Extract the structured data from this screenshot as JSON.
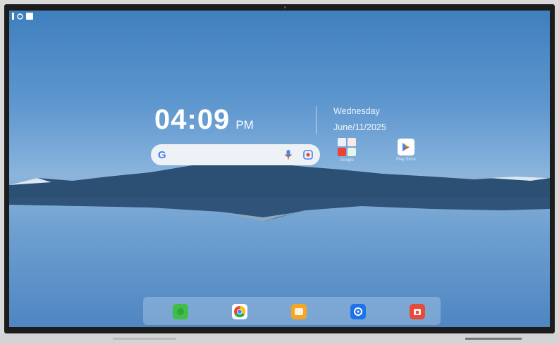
{
  "status_bar": {
    "icons": [
      "sim-icon",
      "settings-circle-icon",
      "square-icon"
    ]
  },
  "clock": {
    "time": "04:09",
    "period": "PM"
  },
  "date_widget": {
    "day": "Wednesday",
    "date": "June/11/2025"
  },
  "search": {
    "logo": "G",
    "icons": [
      "mic-icon",
      "lens-icon"
    ]
  },
  "home_apps": [
    {
      "name": "Google",
      "icon": "google-folder-icon"
    },
    {
      "name": "Play Store",
      "icon": "play-store-icon"
    }
  ],
  "dock": {
    "apps": [
      "green-app-icon",
      "chrome-icon",
      "orange-app-icon",
      "settings-icon",
      "red-app-icon"
    ]
  },
  "colors": {
    "sky_top": "#3f7fbe",
    "horizon": "#8db5db",
    "water_bottom": "#4f86c2",
    "dock_bg": "rgba(200,220,240,0.35)"
  }
}
